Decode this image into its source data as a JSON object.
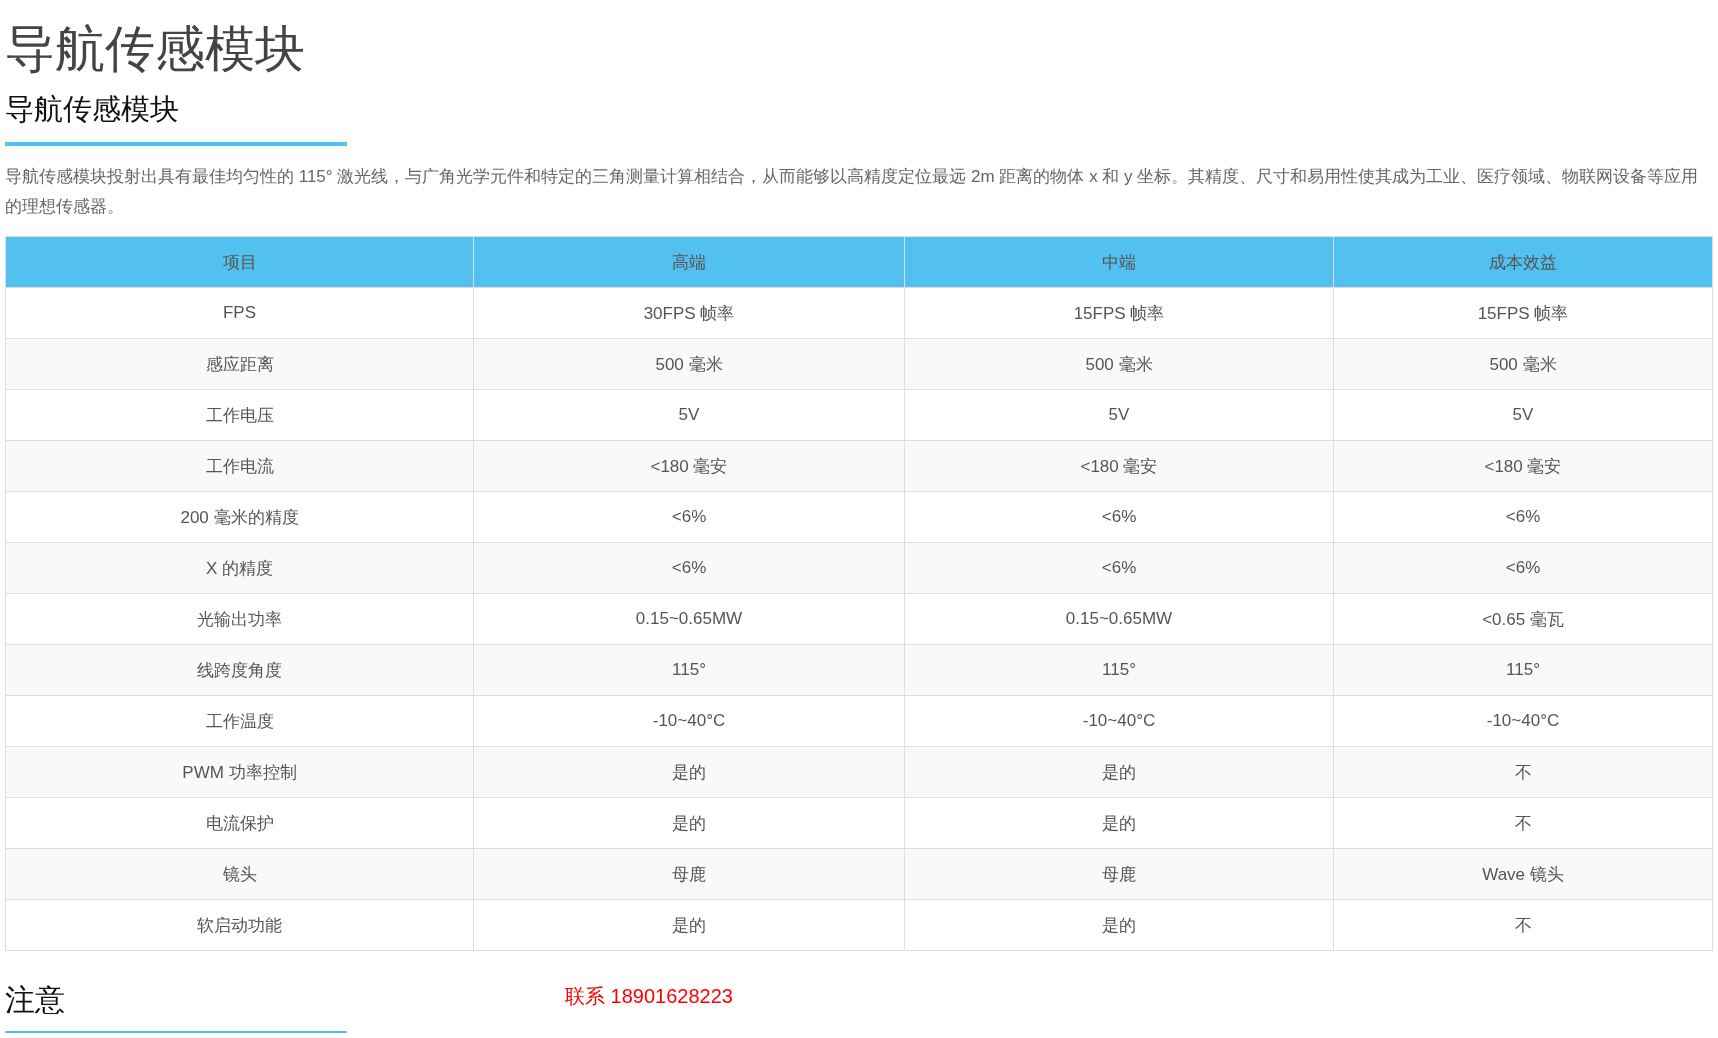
{
  "page_title": "导航传感模块",
  "section_heading": "导航传感模块",
  "description": "导航传感模块投射出具有最佳均匀性的 115° 激光线，与广角光学元件和特定的三角测量计算相结合，从而能够以高精度定位最远 2m 距离的物体 x 和 y 坐标。其精度、尺寸和易用性使其成为工业、医疗领域、物联网设备等应用的理想传感器。",
  "table": {
    "columns": [
      "项目",
      "高端",
      "中端",
      "成本效益"
    ],
    "rows": [
      [
        "FPS",
        "30FPS 帧率",
        "15FPS 帧率",
        "15FPS 帧率"
      ],
      [
        "感应距离",
        "500 毫米",
        "500 毫米",
        "500 毫米"
      ],
      [
        "工作电压",
        "5V",
        "5V",
        "5V"
      ],
      [
        "工作电流",
        "<180 毫安",
        "<180 毫安",
        "<180 毫安"
      ],
      [
        "200 毫米的精度",
        "<6%",
        "<6%",
        "<6%"
      ],
      [
        "X 的精度",
        "<6%",
        "<6%",
        "<6%"
      ],
      [
        "光输出功率",
        "0.15~0.65MW",
        "0.15~0.65MW",
        "<0.65 毫瓦"
      ],
      [
        "线跨度角度",
        "115°",
        "115°",
        "115°"
      ],
      [
        "工作温度",
        "-10~40°C",
        "-10~40°C",
        "-10~40°C"
      ],
      [
        "PWM 功率控制",
        "是的",
        "是的",
        "不"
      ],
      [
        "电流保护",
        "是的",
        "是的",
        "不"
      ],
      [
        "镜头",
        "母鹿",
        "母鹿",
        "Wave 镜头"
      ],
      [
        "软启动功能",
        "是的",
        "是的",
        "不"
      ]
    ]
  },
  "note_heading": "注意",
  "contact": "联系 18901628223"
}
